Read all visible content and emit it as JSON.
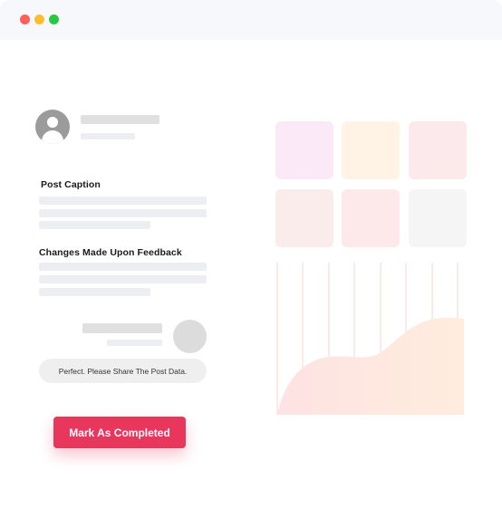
{
  "window": {
    "controls": {
      "close_color": "#fe5f57",
      "minimize_color": "#febc2e",
      "maximize_color": "#28c840"
    }
  },
  "post": {
    "avatar_icon": "user-avatar-icon",
    "caption_heading": "Post Caption",
    "feedback_heading": "Changes Made Upon Feedback"
  },
  "reply": {
    "message": "Perfect. Please Share The Post Data."
  },
  "actions": {
    "complete_label": "Mark As Completed",
    "complete_color": "#e8365c"
  },
  "swatches": {
    "colors": [
      "#fbe9f7",
      "#fff3e6",
      "#fbe9ec",
      "#fbecec",
      "#fde9e9",
      "#f5f5f5"
    ]
  }
}
